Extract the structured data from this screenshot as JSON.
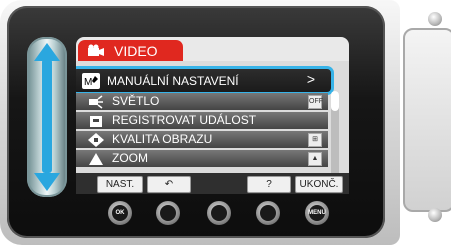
{
  "menu": {
    "tab_label": "VIDEO",
    "items": [
      {
        "label": "MANUÁLNÍ NASTAVENÍ",
        "chevron": ">"
      },
      {
        "label": "SVĚTLO"
      },
      {
        "label": "REGISTROVAT UDÁLOST"
      },
      {
        "label": "KVALITA OBRAZU"
      },
      {
        "label": "ZOOM"
      }
    ]
  },
  "bottom_bar": {
    "buttons": [
      {
        "label": "NAST."
      },
      {
        "label": "↶"
      },
      {
        "label": "?"
      },
      {
        "label": "UKONČ."
      }
    ]
  },
  "hardware_buttons": [
    {
      "label": "OK"
    },
    {
      "label": ""
    },
    {
      "label": ""
    },
    {
      "label": ""
    },
    {
      "label": "MENU"
    }
  ],
  "accent_colors": {
    "tab_red": "#e0281f",
    "selection_cyan": "#37b3e8",
    "slider_blue": "#2aa7df"
  }
}
